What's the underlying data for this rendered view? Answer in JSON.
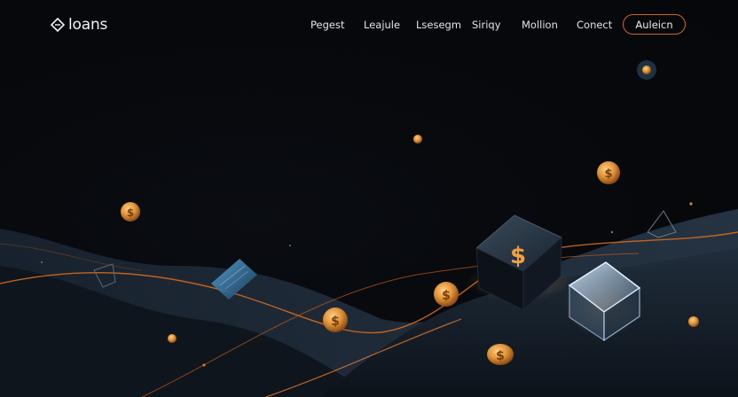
{
  "brand": {
    "name": "loans",
    "icon": "diamond-logo-icon"
  },
  "nav": {
    "items": [
      {
        "label": "Pegest"
      },
      {
        "label": "Leajule"
      },
      {
        "label": "Lsesegm"
      },
      {
        "label": "Siriqy"
      },
      {
        "label": "Mollion"
      },
      {
        "label": "Conect"
      }
    ],
    "cta_label": "Auleicn"
  },
  "scene": {
    "coin_symbol": "$",
    "accent_color": "#c46a28",
    "coin_color": "#e39a3b",
    "glass_color": "#8fb6d8"
  }
}
